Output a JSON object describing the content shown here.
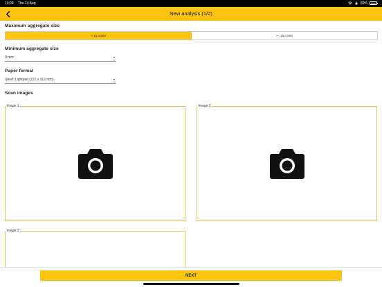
{
  "status_bar": {
    "time": "10:09",
    "date": "Thu 24 Aug",
    "battery": "89%",
    "battery_level": 0.89
  },
  "nav": {
    "title": "New analysis (1/2)",
    "back_icon": "chevron-left-icon"
  },
  "max_aggregate": {
    "label": "Maximum aggregate size",
    "options": [
      "< 16.0 MM",
      ">= 16.0 MM"
    ],
    "selected_index": 0
  },
  "min_aggregate": {
    "label": "Minimum aggregate size",
    "value": "0 mm"
  },
  "paper_format": {
    "label": "Paper format",
    "value": "Sika® Lightpad (222 x 312 mm)"
  },
  "scan_images": {
    "label": "Scan images",
    "slots": [
      {
        "label": "Image 1",
        "icon": "camera-icon"
      },
      {
        "label": "Image 2",
        "icon": "camera-icon"
      },
      {
        "label": "Image 3",
        "icon": "camera-icon"
      }
    ]
  },
  "footer": {
    "next_label": "NEXT"
  },
  "colors": {
    "accent": "#fec40f",
    "slot_border": "#f0c44a",
    "text": "#222222"
  }
}
